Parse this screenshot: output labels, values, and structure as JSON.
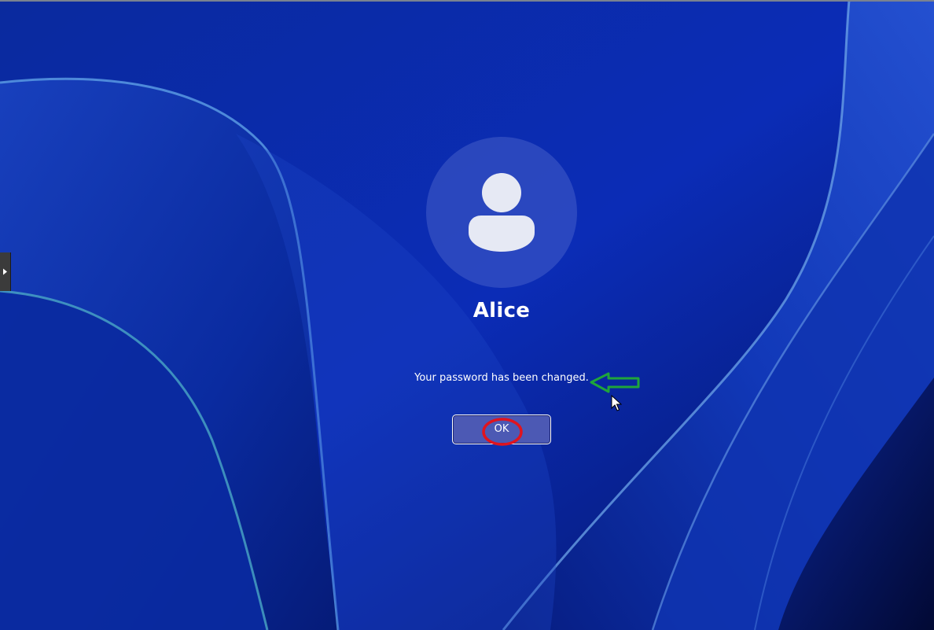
{
  "user": {
    "name": "Alice"
  },
  "message": {
    "text": "Your password has been changed."
  },
  "actions": {
    "ok_label": "OK"
  },
  "icons": {
    "avatar": "person-icon",
    "side_tab": "expand-arrow-icon",
    "cursor": "mouse-pointer-icon"
  },
  "colors": {
    "wallpaper_base": "#0a2aa8",
    "button_fill": "#4c59b4",
    "annotation_arrow": "#1fa53b",
    "annotation_ellipse": "#e0141e"
  }
}
